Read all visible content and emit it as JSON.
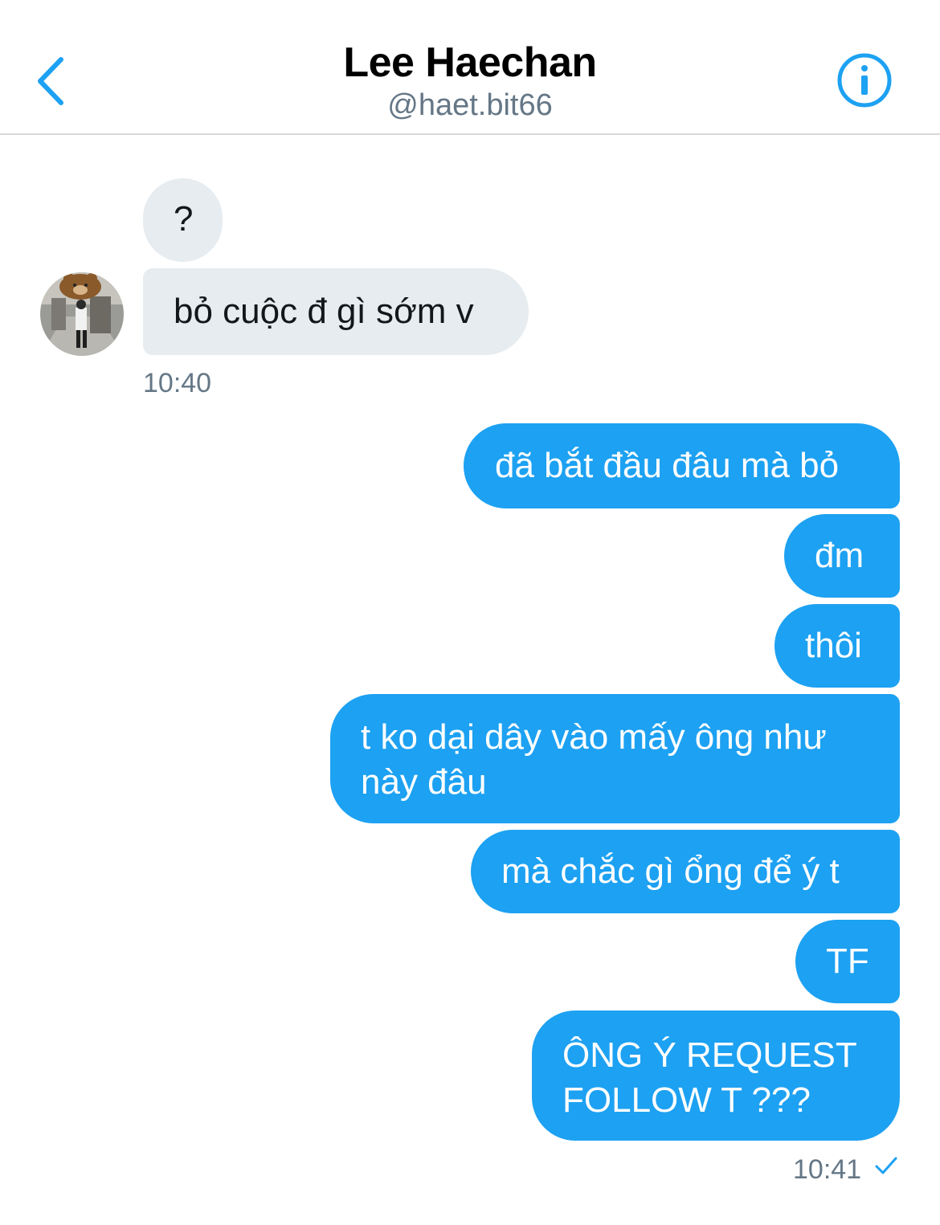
{
  "header": {
    "title": "Lee Haechan",
    "handle": "@haet.bit66",
    "back_icon": "chevron-left-icon",
    "info_icon": "info-icon",
    "accent_color": "#1da1f2"
  },
  "received": {
    "messages": [
      "?",
      "bỏ cuộc đ gì sớm v"
    ],
    "time": "10:40",
    "bubble_color": "#e6ecf0"
  },
  "sent": {
    "messages": [
      "đã bắt đầu đâu mà bỏ",
      "đm",
      "thôi",
      "t ko dại dây vào mấy ông như",
      "này đâu",
      "mà chắc gì ổng để ý t",
      "TF",
      "ÔNG Ý REQUEST",
      "FOLLOW T ???"
    ],
    "time": "10:41",
    "status_icon": "check-icon",
    "bubble_color": "#1da1f2"
  }
}
